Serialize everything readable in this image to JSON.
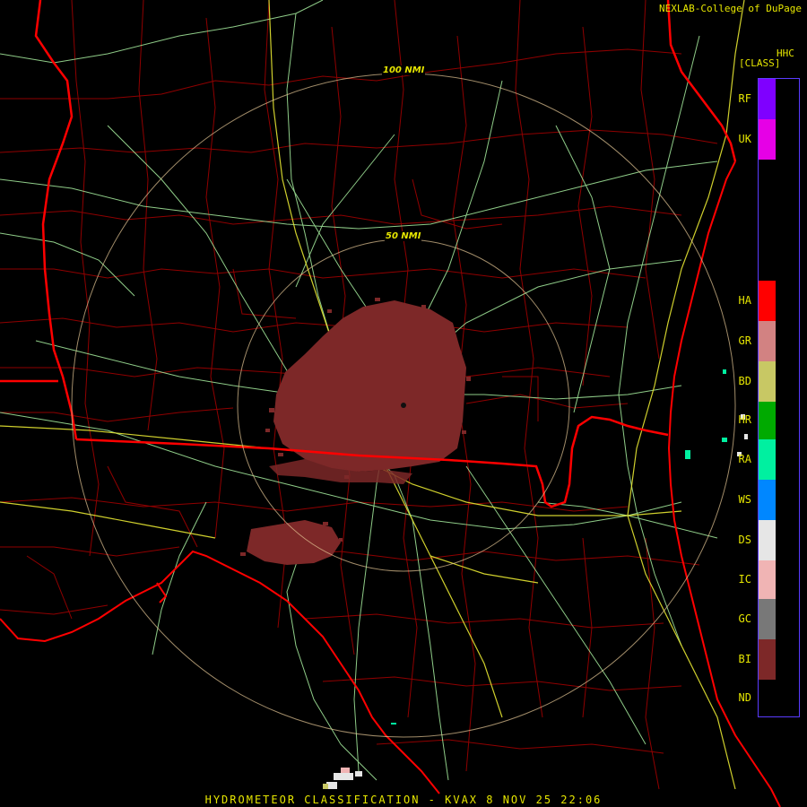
{
  "header": {
    "credit": "NEXLAB-College of DuPage",
    "product_code": "HHC",
    "product_class": "[CLASS]"
  },
  "footer": {
    "title": "HYDROMETEOR CLASSIFICATION - KVAX 8 NOV 25 22:06"
  },
  "range_rings": [
    "100 NMI",
    "50 NMI"
  ],
  "legend": [
    {
      "code": "RF",
      "color": "#7f00ff"
    },
    {
      "code": "UK",
      "color": "#e600e6"
    },
    {
      "code": "HA",
      "color": "#ff0000"
    },
    {
      "code": "GR",
      "color": "#d28282"
    },
    {
      "code": "BD",
      "color": "#c8c864"
    },
    {
      "code": "HR",
      "color": "#00aa00"
    },
    {
      "code": "RA",
      "color": "#00f0a0"
    },
    {
      "code": "WS",
      "color": "#0087ff"
    },
    {
      "code": "DS",
      "color": "#e6e6e6"
    },
    {
      "code": "IC",
      "color": "#f0b4b4"
    },
    {
      "code": "GC",
      "color": "#787878"
    },
    {
      "code": "BI",
      "color": "#7d2828"
    },
    {
      "code": "ND",
      "color": "#000000"
    }
  ],
  "colors": {
    "state_border": "#ff0000",
    "county_border": "#a00000",
    "highway": "#a8f0a0",
    "interstate": "#e6e632",
    "ring": "#e6c896",
    "echo": "#7d2828"
  }
}
